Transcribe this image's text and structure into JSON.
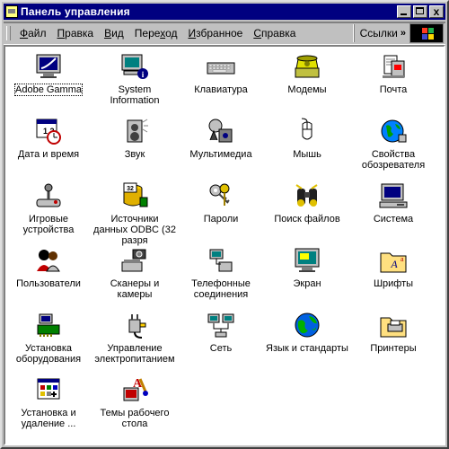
{
  "window": {
    "title": "Панель управления",
    "min_label": "",
    "max_label": "",
    "close_label": "x"
  },
  "menu": {
    "items": [
      {
        "label": "Файл",
        "underline": "Ф"
      },
      {
        "label": "Правка",
        "underline": "П"
      },
      {
        "label": "Вид",
        "underline": "В"
      },
      {
        "label": "Переход",
        "underline": "х"
      },
      {
        "label": "Избранное",
        "underline": "И"
      },
      {
        "label": "Справка",
        "underline": "С"
      }
    ],
    "links_label": "Ссылки",
    "links_chevron": "»"
  },
  "colors": {
    "titlebar": "#000080",
    "face": "#c0c0c0",
    "client": "#ffffff"
  },
  "items": [
    {
      "label": "Adobe Gamma",
      "icon": "monitor-gamma-icon",
      "focused": true
    },
    {
      "label": "System Information",
      "icon": "computer-info-icon"
    },
    {
      "label": "Клавиатура",
      "icon": "keyboard-icon"
    },
    {
      "label": "Модемы",
      "icon": "modem-phone-icon"
    },
    {
      "label": "Почта",
      "icon": "mail-icon"
    },
    {
      "label": "Дата и время",
      "icon": "calendar-clock-icon"
    },
    {
      "label": "Звук",
      "icon": "speaker-icon"
    },
    {
      "label": "Мультимедиа",
      "icon": "multimedia-icon"
    },
    {
      "label": "Мышь",
      "icon": "mouse-icon"
    },
    {
      "label": "Свойства обозревателя",
      "icon": "internet-globe-icon"
    },
    {
      "label": "Игровые устройства",
      "icon": "joystick-icon"
    },
    {
      "label": "Источники данных ODBC (32 разря",
      "icon": "odbc-database-icon"
    },
    {
      "label": "Пароли",
      "icon": "keys-icon"
    },
    {
      "label": "Поиск файлов",
      "icon": "binoculars-icon"
    },
    {
      "label": "Система",
      "icon": "computer-icon"
    },
    {
      "label": "Пользователи",
      "icon": "users-icon"
    },
    {
      "label": "Сканеры и камеры",
      "icon": "scanner-camera-icon"
    },
    {
      "label": "Телефонные соединения",
      "icon": "telephony-icon"
    },
    {
      "label": "Экран",
      "icon": "display-icon"
    },
    {
      "label": "Шрифты",
      "icon": "fonts-folder-icon"
    },
    {
      "label": "Установка оборудования",
      "icon": "hardware-install-icon"
    },
    {
      "label": "Управление электропитанием",
      "icon": "power-plug-icon"
    },
    {
      "label": "Сеть",
      "icon": "network-icon"
    },
    {
      "label": "Язык и стандарты",
      "icon": "globe-icon"
    },
    {
      "label": "Принтеры",
      "icon": "printers-folder-icon"
    },
    {
      "label": "Установка и удаление ...",
      "icon": "add-remove-programs-icon"
    },
    {
      "label": "Темы рабочего стола",
      "icon": "desktop-themes-icon"
    }
  ]
}
